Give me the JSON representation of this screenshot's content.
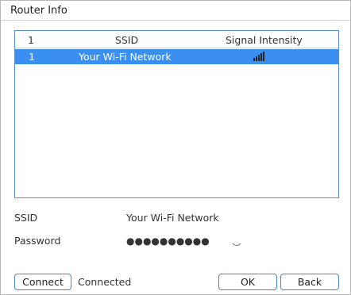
{
  "dialog": {
    "title": "Router Info"
  },
  "list": {
    "headers": {
      "index": "1",
      "ssid": "SSID",
      "signal": "Signal Intensity"
    },
    "rows": [
      {
        "index": "1",
        "ssid": "Your Wi-Fi Network",
        "signal_icon": "signal-strength-icon",
        "signal_level": "5/5",
        "selected": true
      }
    ],
    "selected_color": "#3b8ff0"
  },
  "fields": {
    "ssid_label": "SSID",
    "ssid_value": "Your Wi-Fi Network",
    "password_label": "Password",
    "password_value": "●●●●●●●●●●",
    "reveal_icon": "eye-closed-icon"
  },
  "footer": {
    "connect_label": "Connect",
    "status_text": "Connected",
    "ok_label": "OK",
    "back_label": "Back"
  },
  "colors": {
    "accent_border": "#4f87c4",
    "list_border": "#5b8fc7"
  }
}
